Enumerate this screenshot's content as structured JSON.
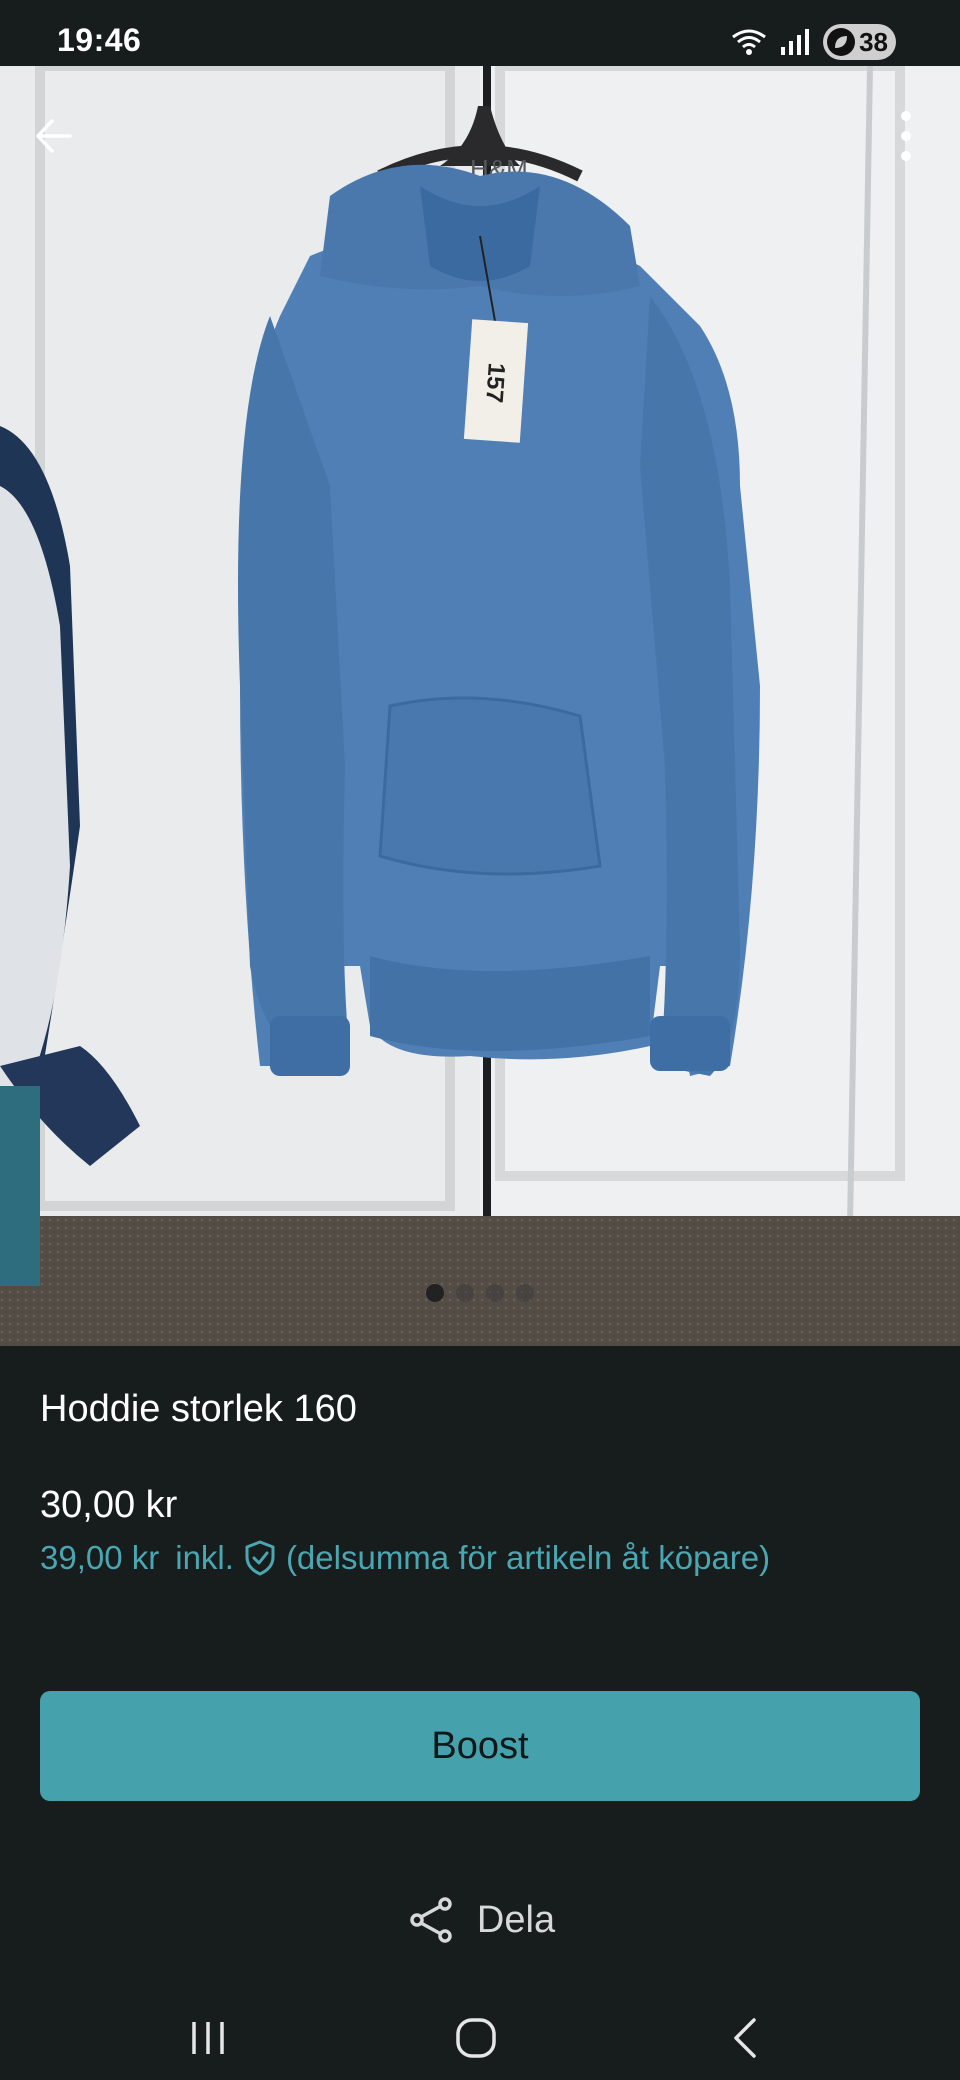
{
  "status_bar": {
    "time": "19:46",
    "battery": "38",
    "icons": [
      "wifi-icon",
      "signal-icon",
      "battery-icon"
    ]
  },
  "photo": {
    "tag_text": "157",
    "hanger_text": "H&M",
    "page_count": 4,
    "active_page": 1
  },
  "header": {
    "back_icon": "arrow-left-icon",
    "more_icon": "more-vertical-icon"
  },
  "listing": {
    "title": "Hoddie storlek 160",
    "price": "30,00 kr",
    "price_incl": "39,00 kr",
    "incl_label": "inkl.",
    "incl_note": "(delsumma för artikeln åt köpare)"
  },
  "actions": {
    "boost_label": "Boost",
    "share_label": "Dela"
  },
  "colors": {
    "background": "#171c1d",
    "accent": "#45a1ab",
    "accent_text": "#4aa7b2",
    "hoodie": "#4f7fb5"
  }
}
